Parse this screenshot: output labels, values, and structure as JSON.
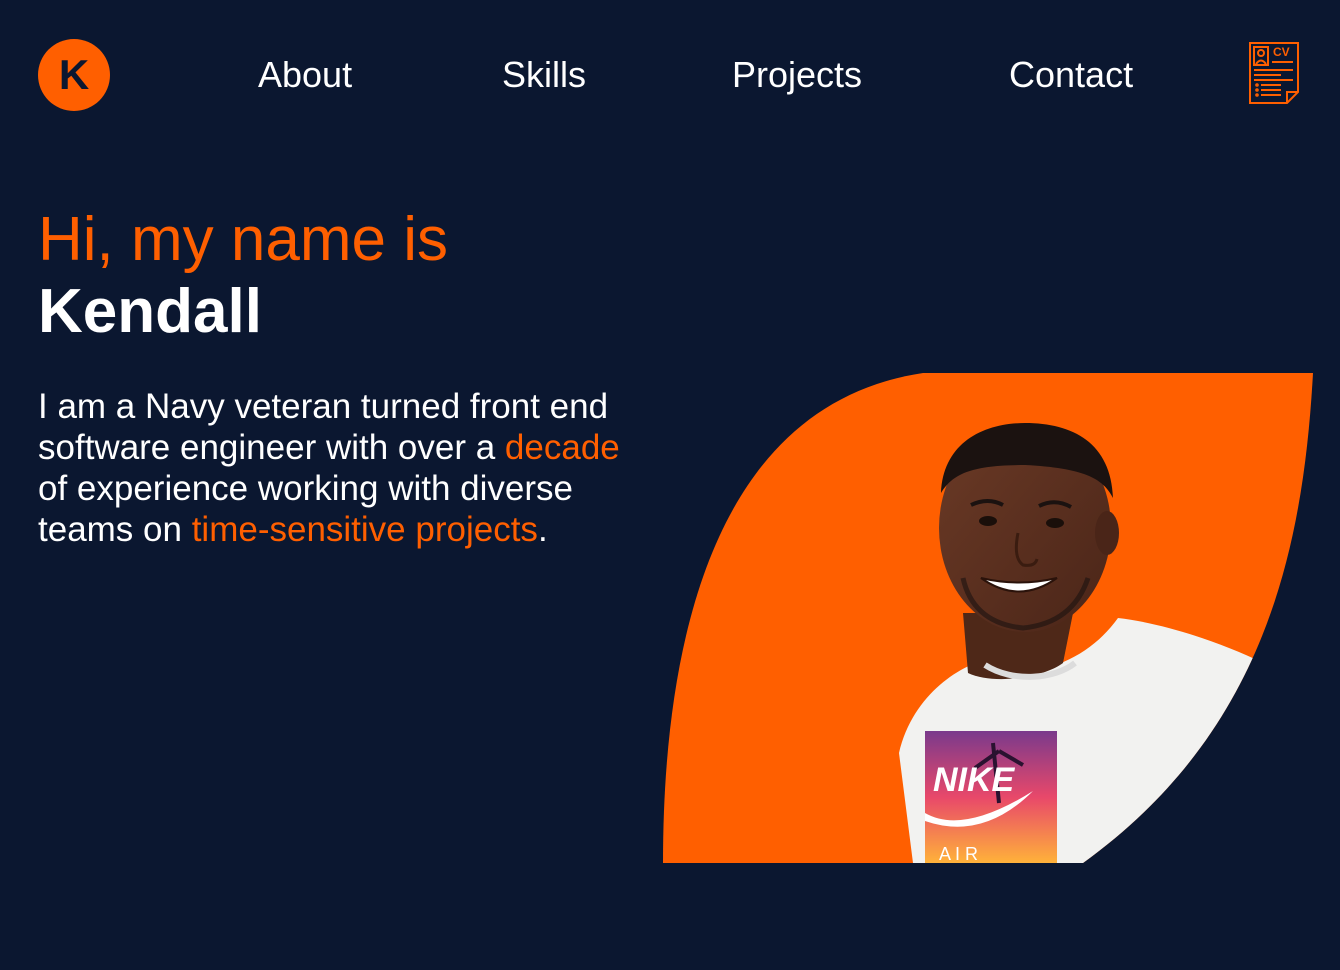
{
  "header": {
    "logo_letter": "K",
    "nav": [
      {
        "label": "About"
      },
      {
        "label": "Skills"
      },
      {
        "label": "Projects"
      },
      {
        "label": "Contact"
      }
    ],
    "cv_icon_text": "CV",
    "cv_icon": "resume-cv-icon"
  },
  "hero": {
    "greeting": "Hi, my name is",
    "name": "Kendall",
    "bio": {
      "part1": "I am a Navy veteran turned front end software engineer with over a ",
      "highlight1": "decade",
      "part2": " of experience working with diverse teams on ",
      "highlight2": "time-sensitive projects",
      "part3": "."
    },
    "portrait_shirt_text": "NIKE",
    "portrait_shirt_subtext": "A I R"
  },
  "colors": {
    "background": "#0b1730",
    "accent": "#ff5f00",
    "text": "#ffffff"
  }
}
